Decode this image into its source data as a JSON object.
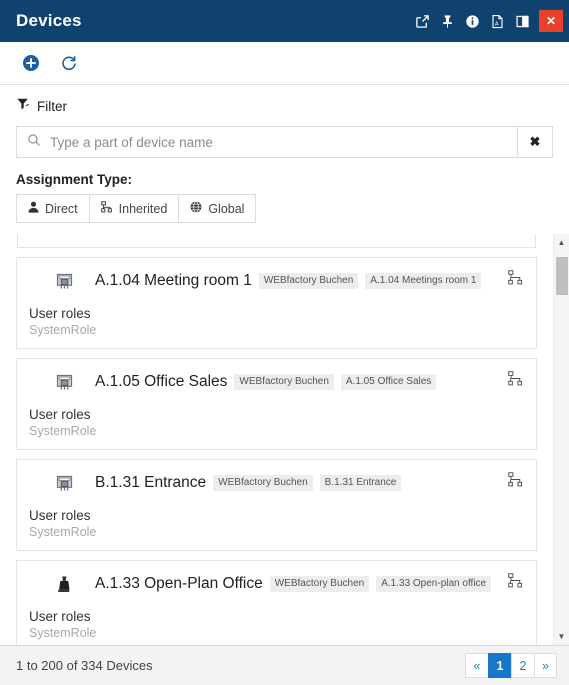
{
  "titlebar": {
    "title": "Devices",
    "actions": [
      {
        "name": "open-external-icon",
        "glyph": "external"
      },
      {
        "name": "pin-icon",
        "glyph": "pin"
      },
      {
        "name": "info-icon",
        "glyph": "info"
      },
      {
        "name": "pdf-export-icon",
        "glyph": "pdf"
      },
      {
        "name": "dock-panel-icon",
        "glyph": "dock"
      }
    ],
    "close_label": "✕"
  },
  "toolbar": {
    "add_label": "add-icon",
    "refresh_label": "refresh-icon"
  },
  "filter": {
    "heading": "Filter",
    "search_placeholder": "Type a part of device name",
    "search_value": "",
    "clear_label": "✖",
    "assignment_label": "Assignment Type:",
    "assignment_types": [
      {
        "label": "Direct",
        "icon": "user-icon"
      },
      {
        "label": "Inherited",
        "icon": "inherited-icon"
      },
      {
        "label": "Global",
        "icon": "globe-icon"
      }
    ]
  },
  "devices": [
    {
      "name": "A.1.04 Meeting room 1",
      "icon": "server-rack-icon",
      "tags": [
        "WEBfactory Buchen",
        "A.1.04 Meetings room 1"
      ],
      "roles_title": "User roles",
      "roles_value": "SystemRole"
    },
    {
      "name": "A.1.05 Office Sales",
      "icon": "server-rack-icon",
      "tags": [
        "WEBfactory Buchen",
        "A.1.05 Office Sales"
      ],
      "roles_title": "User roles",
      "roles_value": "SystemRole"
    },
    {
      "name": "B.1.31 Entrance",
      "icon": "server-rack-icon",
      "tags": [
        "WEBfactory Buchen",
        "B.1.31 Entrance"
      ],
      "roles_title": "User roles",
      "roles_value": "SystemRole"
    },
    {
      "name": "A.1.33 Open-Plan Office",
      "icon": "factory-icon",
      "tags": [
        "WEBfactory Buchen",
        "A.1.33 Open-plan office"
      ],
      "roles_title": "User roles",
      "roles_value": "SystemRole"
    }
  ],
  "scrollbar": {
    "up_label": "▲",
    "down_label": "▼"
  },
  "footer": {
    "status": "1 to 200 of 334 Devices",
    "pager": [
      {
        "label": "«",
        "active": false,
        "name": "pager-prev"
      },
      {
        "label": "1",
        "active": true,
        "name": "pager-page-1"
      },
      {
        "label": "2",
        "active": false,
        "name": "pager-page-2"
      },
      {
        "label": "»",
        "active": false,
        "name": "pager-next"
      }
    ]
  },
  "colors": {
    "header_bg": "#104270",
    "close_red": "#e8402a",
    "accent_blue": "#1877c9",
    "link_blue": "#1f7fc4",
    "tag_bg": "#ededed"
  }
}
